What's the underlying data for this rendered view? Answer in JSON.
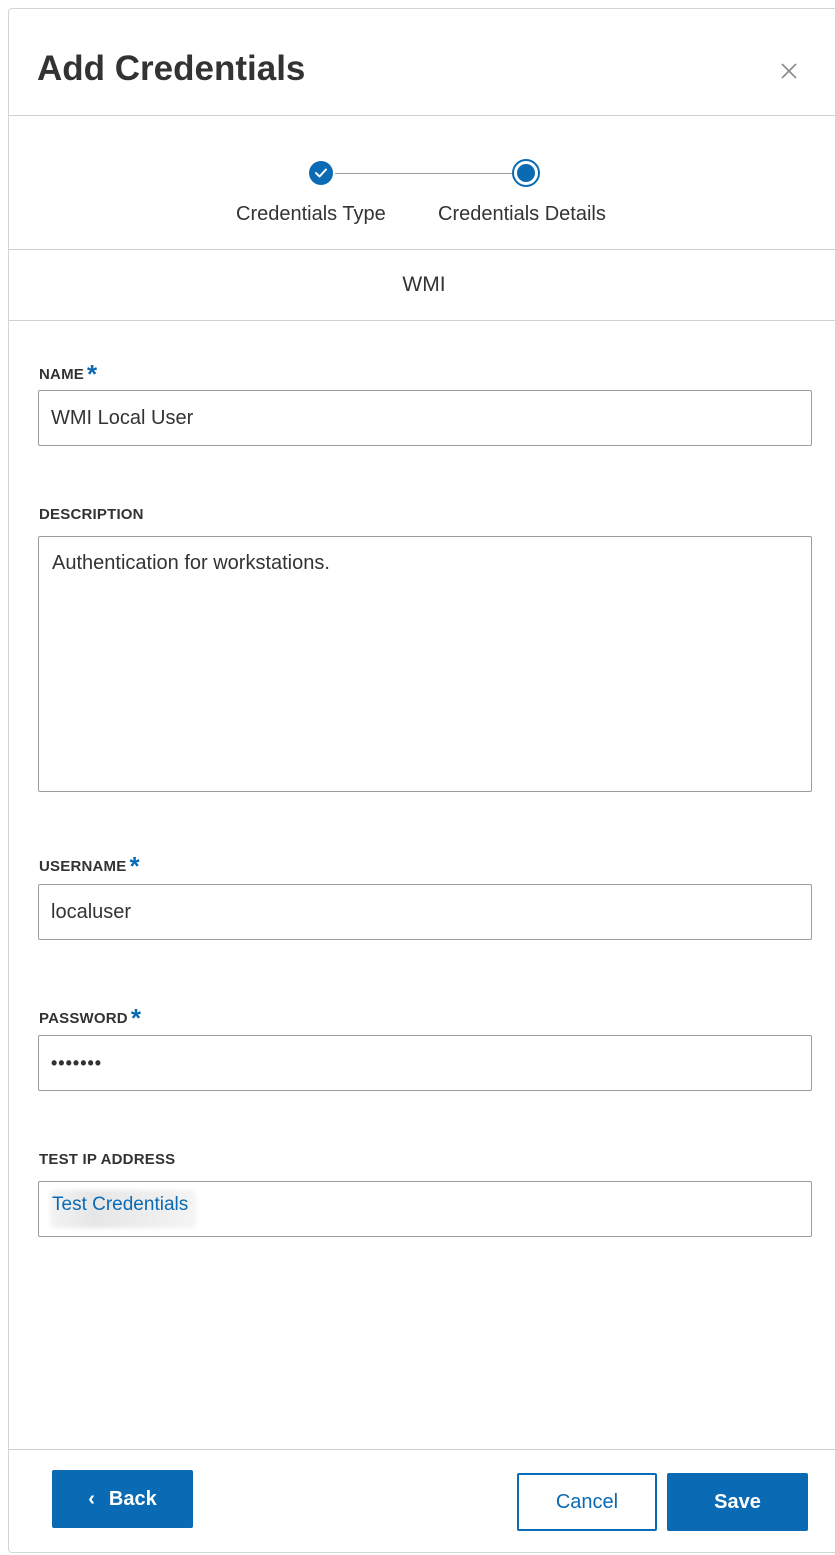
{
  "dialog": {
    "title": "Add Credentials"
  },
  "stepper": {
    "steps": [
      {
        "label": "Credentials Type",
        "state": "completed"
      },
      {
        "label": "Credentials Details",
        "state": "active"
      }
    ]
  },
  "credential_type": "WMI",
  "form": {
    "name": {
      "label": "NAME",
      "required": true,
      "value": "WMI Local User"
    },
    "description": {
      "label": "DESCRIPTION",
      "required": false,
      "value": "Authentication for workstations."
    },
    "username": {
      "label": "USERNAME",
      "required": true,
      "value": "localuser"
    },
    "password": {
      "label": "PASSWORD",
      "required": true,
      "masked_value": "•••••••"
    },
    "test_ip": {
      "label": "TEST IP ADDRESS",
      "required": false,
      "value_obscured": true
    },
    "required_marker": "*"
  },
  "links": {
    "test_credentials": "Test Credentials"
  },
  "footer": {
    "back_label": "Back",
    "back_icon": "chevron-left-icon",
    "cancel_label": "Cancel",
    "save_label": "Save"
  },
  "colors": {
    "accent": "#0a6ab4",
    "border": "#9c9c9c",
    "divider": "#cfcfcf",
    "text": "#333333"
  }
}
